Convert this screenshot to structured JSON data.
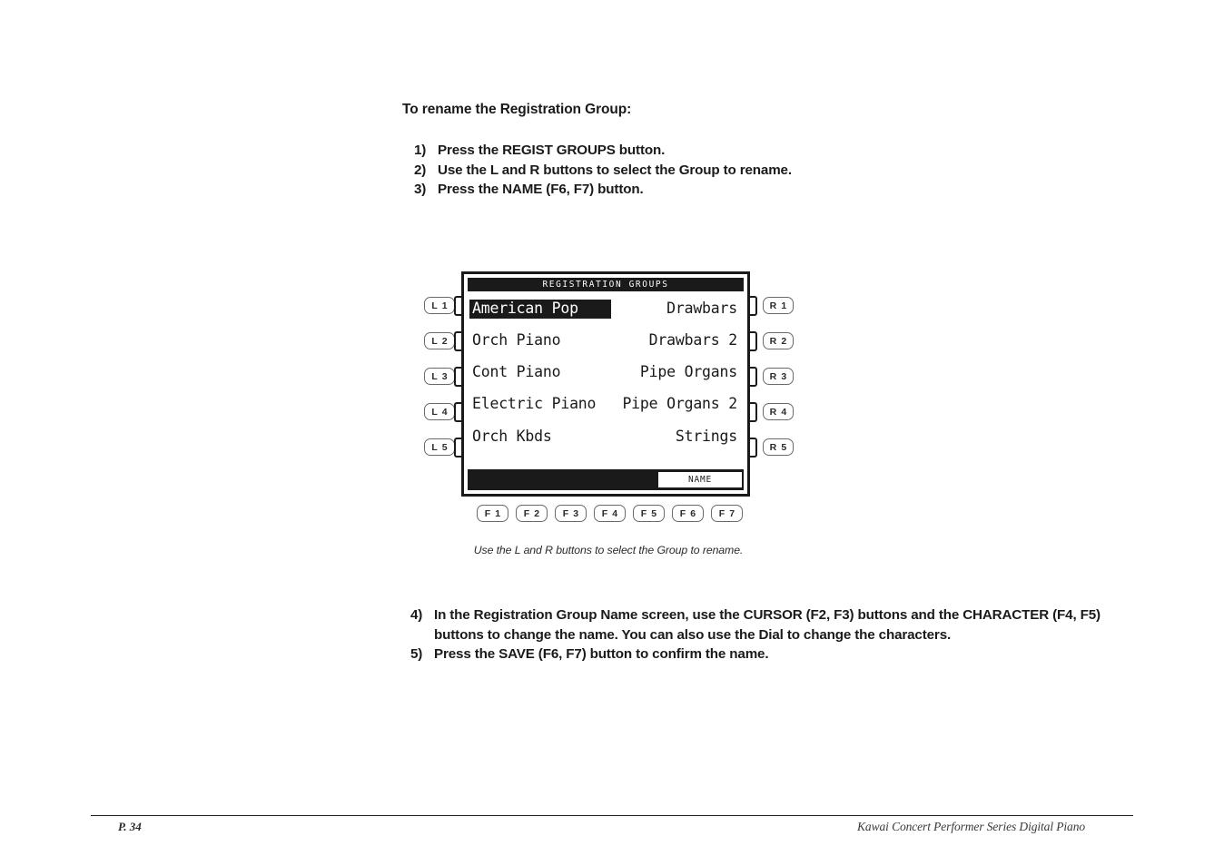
{
  "page": {
    "heading": "To rename the Registration Group:",
    "steps_top": [
      {
        "num": "1)",
        "text": "Press the REGIST GROUPS button."
      },
      {
        "num": "2)",
        "text": "Use the L and R buttons to select the Group to rename."
      },
      {
        "num": "3)",
        "text": "Press the NAME (F6, F7) button."
      }
    ],
    "steps_bottom": [
      {
        "num": "4)",
        "text": "In the Registration Group Name screen, use the CURSOR (F2, F3) buttons and the CHARACTER (F4, F5) buttons to change the name.  You can also use the Dial to change the characters."
      },
      {
        "num": "5)",
        "text": "Press the SAVE (F6, F7) button to confirm the name."
      }
    ],
    "caption": "Use the L and R buttons to select the Group to rename."
  },
  "lcd": {
    "title": "REGISTRATION GROUPS",
    "rows": [
      {
        "left": "American Pop",
        "right": "Drawbars",
        "selected": true
      },
      {
        "left": "Orch Piano",
        "right": "Drawbars 2",
        "selected": false
      },
      {
        "left": "Cont Piano",
        "right": "Pipe Organs",
        "selected": false
      },
      {
        "left": "Electric Piano",
        "right": "Pipe Organs 2",
        "selected": false
      },
      {
        "left": "Orch Kbds",
        "right": "Strings",
        "selected": false
      }
    ],
    "softkey_name": "NAME"
  },
  "buttons": {
    "left": [
      "L 1",
      "L 2",
      "L 3",
      "L 4",
      "L 5"
    ],
    "right": [
      "R 1",
      "R 2",
      "R 3",
      "R 4",
      "R 5"
    ],
    "function": [
      "F 1",
      "F 2",
      "F 3",
      "F 4",
      "F 5",
      "F 6",
      "F 7"
    ]
  },
  "footer": {
    "page_number": "P. 34",
    "product": "Kawai Concert Performer Series Digital Piano"
  },
  "colors": {
    "ink": "#1a1a1a",
    "paper": "#ffffff",
    "button_border": "#6a6a6a"
  }
}
